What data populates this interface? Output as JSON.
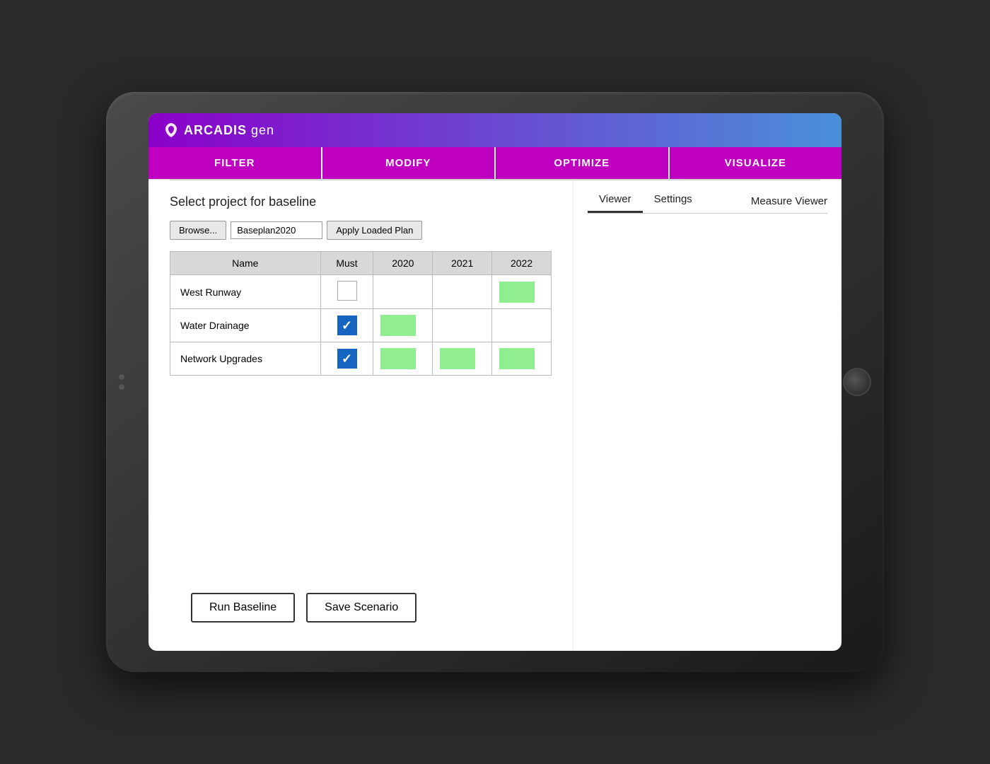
{
  "app": {
    "logo_icon": "arcadis-logo",
    "logo_brand": "ARCADIS",
    "logo_sub": " gen"
  },
  "nav": {
    "items": [
      "FILTER",
      "MODIFY",
      "OPTIMIZE",
      "VISUALIZE"
    ]
  },
  "left": {
    "section_title": "Select project for baseline",
    "browse_label": "Browse...",
    "file_value": "Baseplan2020",
    "apply_label": "Apply Loaded Plan",
    "table": {
      "headers": [
        "Name",
        "Must",
        "2020",
        "2021",
        "2022"
      ],
      "rows": [
        {
          "name": "West Runway",
          "must": "unchecked",
          "2020": "empty",
          "2021": "empty",
          "2022": "green"
        },
        {
          "name": "Water Drainage",
          "must": "checked",
          "2020": "green",
          "2021": "empty",
          "2022": "empty"
        },
        {
          "name": "Network Upgrades",
          "must": "checked",
          "2020": "green",
          "2021": "green",
          "2022": "green"
        }
      ]
    },
    "run_baseline_label": "Run Baseline",
    "save_scenario_label": "Save Scenario"
  },
  "right": {
    "tabs": [
      "Viewer",
      "Settings"
    ],
    "right_link": "Measure Viewer"
  }
}
